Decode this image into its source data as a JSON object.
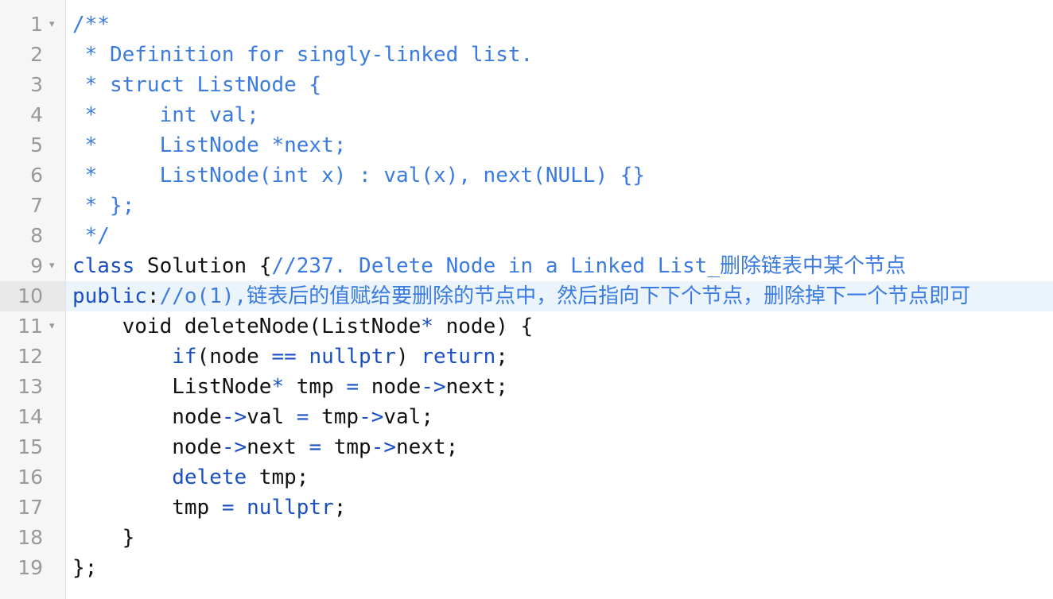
{
  "editor": {
    "active_line_number": "10",
    "colors": {
      "comment": "#3b7be0",
      "keyword": "#1a4fc4",
      "plain": "#111111",
      "gutter_bg": "#f6f6f6",
      "active_bg": "#ebf4fb"
    },
    "lines": [
      {
        "num": "1",
        "fold": "▾",
        "tokens": [
          {
            "t": "/**",
            "c": "comment"
          }
        ]
      },
      {
        "num": "2",
        "fold": "",
        "tokens": [
          {
            "t": " * Definition for singly-linked list.",
            "c": "comment"
          }
        ]
      },
      {
        "num": "3",
        "fold": "",
        "tokens": [
          {
            "t": " * struct ListNode {",
            "c": "comment"
          }
        ]
      },
      {
        "num": "4",
        "fold": "",
        "tokens": [
          {
            "t": " *     int val;",
            "c": "comment"
          }
        ]
      },
      {
        "num": "5",
        "fold": "",
        "tokens": [
          {
            "t": " *     ListNode *next;",
            "c": "comment"
          }
        ]
      },
      {
        "num": "6",
        "fold": "",
        "tokens": [
          {
            "t": " *     ListNode(int x) : val(x), next(NULL) {}",
            "c": "comment"
          }
        ]
      },
      {
        "num": "7",
        "fold": "",
        "tokens": [
          {
            "t": " * };",
            "c": "comment"
          }
        ]
      },
      {
        "num": "8",
        "fold": "",
        "tokens": [
          {
            "t": " */",
            "c": "comment"
          }
        ]
      },
      {
        "num": "9",
        "fold": "▾",
        "tokens": [
          {
            "t": "class",
            "c": "kw"
          },
          {
            "t": " Solution {",
            "c": "plain"
          },
          {
            "t": "//237. Delete Node in a Linked List_删除链表中某个节点",
            "c": "comment"
          }
        ]
      },
      {
        "num": "10",
        "fold": "",
        "tokens": [
          {
            "t": "public",
            "c": "kw"
          },
          {
            "t": ":",
            "c": "plain"
          },
          {
            "t": "//o(1),链表后的值赋给要删除的节点中，然后指向下下个节点，删除掉下一个节点即可",
            "c": "comment"
          }
        ]
      },
      {
        "num": "11",
        "fold": "▾",
        "tokens": [
          {
            "t": "    void deleteNode(ListNode",
            "c": "plain"
          },
          {
            "t": "*",
            "c": "op"
          },
          {
            "t": " node) {",
            "c": "plain"
          }
        ]
      },
      {
        "num": "12",
        "fold": "",
        "tokens": [
          {
            "t": "        ",
            "c": "plain"
          },
          {
            "t": "if",
            "c": "kw"
          },
          {
            "t": "(node ",
            "c": "plain"
          },
          {
            "t": "==",
            "c": "op"
          },
          {
            "t": " ",
            "c": "plain"
          },
          {
            "t": "nullptr",
            "c": "kw"
          },
          {
            "t": ") ",
            "c": "plain"
          },
          {
            "t": "return",
            "c": "kw"
          },
          {
            "t": ";",
            "c": "plain"
          }
        ]
      },
      {
        "num": "13",
        "fold": "",
        "tokens": [
          {
            "t": "        ListNode",
            "c": "plain"
          },
          {
            "t": "*",
            "c": "op"
          },
          {
            "t": " tmp ",
            "c": "plain"
          },
          {
            "t": "=",
            "c": "op"
          },
          {
            "t": " node",
            "c": "plain"
          },
          {
            "t": "->",
            "c": "op"
          },
          {
            "t": "next;",
            "c": "plain"
          }
        ]
      },
      {
        "num": "14",
        "fold": "",
        "tokens": [
          {
            "t": "        node",
            "c": "plain"
          },
          {
            "t": "->",
            "c": "op"
          },
          {
            "t": "val ",
            "c": "plain"
          },
          {
            "t": "=",
            "c": "op"
          },
          {
            "t": " tmp",
            "c": "plain"
          },
          {
            "t": "->",
            "c": "op"
          },
          {
            "t": "val;",
            "c": "plain"
          }
        ]
      },
      {
        "num": "15",
        "fold": "",
        "tokens": [
          {
            "t": "        node",
            "c": "plain"
          },
          {
            "t": "->",
            "c": "op"
          },
          {
            "t": "next ",
            "c": "plain"
          },
          {
            "t": "=",
            "c": "op"
          },
          {
            "t": " tmp",
            "c": "plain"
          },
          {
            "t": "->",
            "c": "op"
          },
          {
            "t": "next;",
            "c": "plain"
          }
        ]
      },
      {
        "num": "16",
        "fold": "",
        "tokens": [
          {
            "t": "        ",
            "c": "plain"
          },
          {
            "t": "delete",
            "c": "kw"
          },
          {
            "t": " tmp;",
            "c": "plain"
          }
        ]
      },
      {
        "num": "17",
        "fold": "",
        "tokens": [
          {
            "t": "        tmp ",
            "c": "plain"
          },
          {
            "t": "=",
            "c": "op"
          },
          {
            "t": " ",
            "c": "plain"
          },
          {
            "t": "nullptr",
            "c": "kw"
          },
          {
            "t": ";",
            "c": "plain"
          }
        ]
      },
      {
        "num": "18",
        "fold": "",
        "tokens": [
          {
            "t": "    }",
            "c": "plain"
          }
        ]
      },
      {
        "num": "19",
        "fold": "",
        "tokens": [
          {
            "t": "};",
            "c": "plain"
          }
        ]
      }
    ]
  }
}
